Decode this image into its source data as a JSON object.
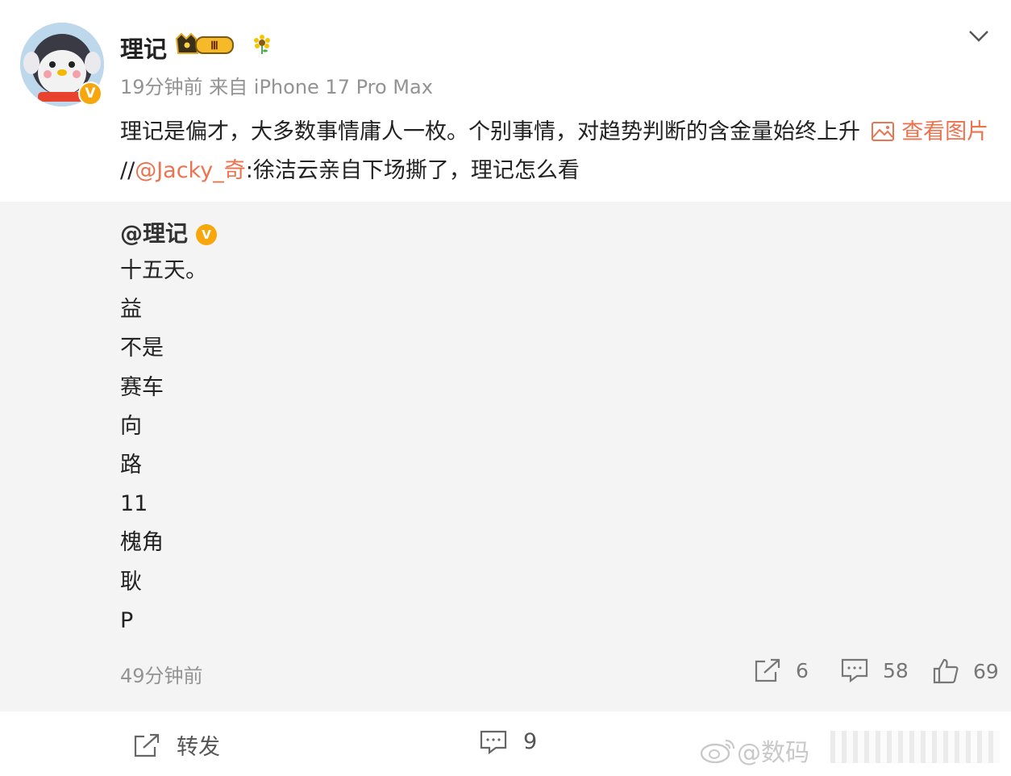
{
  "post": {
    "username": "理记",
    "level_badge": "Ⅲ",
    "meta": "19分钟前 来自 iPhone 17 Pro Max",
    "text_before": "理记是偏才，大多数事情庸人一枚。个别事情，对趋势判断的含金量始终上升",
    "view_image": "查看图片",
    "separator": " //",
    "mention": "@Jacky_奇",
    "text_after": ":徐洁云亲自下场撕了，理记怎么看",
    "verified_mark": "V"
  },
  "repost": {
    "username": "@理记",
    "verified_mark": "V",
    "lines": [
      "十五天。",
      "益",
      "不是",
      "赛车",
      "向",
      "路",
      "11",
      "槐角",
      "耿",
      "P"
    ],
    "time": "49分钟前",
    "shares": "6",
    "comments": "58",
    "likes": "69"
  },
  "bottom_bar": {
    "forward_label": "转发",
    "comment_count": "9",
    "watermark": "@数码"
  },
  "colors": {
    "link": "#eb7350",
    "badge": "#f7a70b",
    "gray_text": "#939393"
  }
}
